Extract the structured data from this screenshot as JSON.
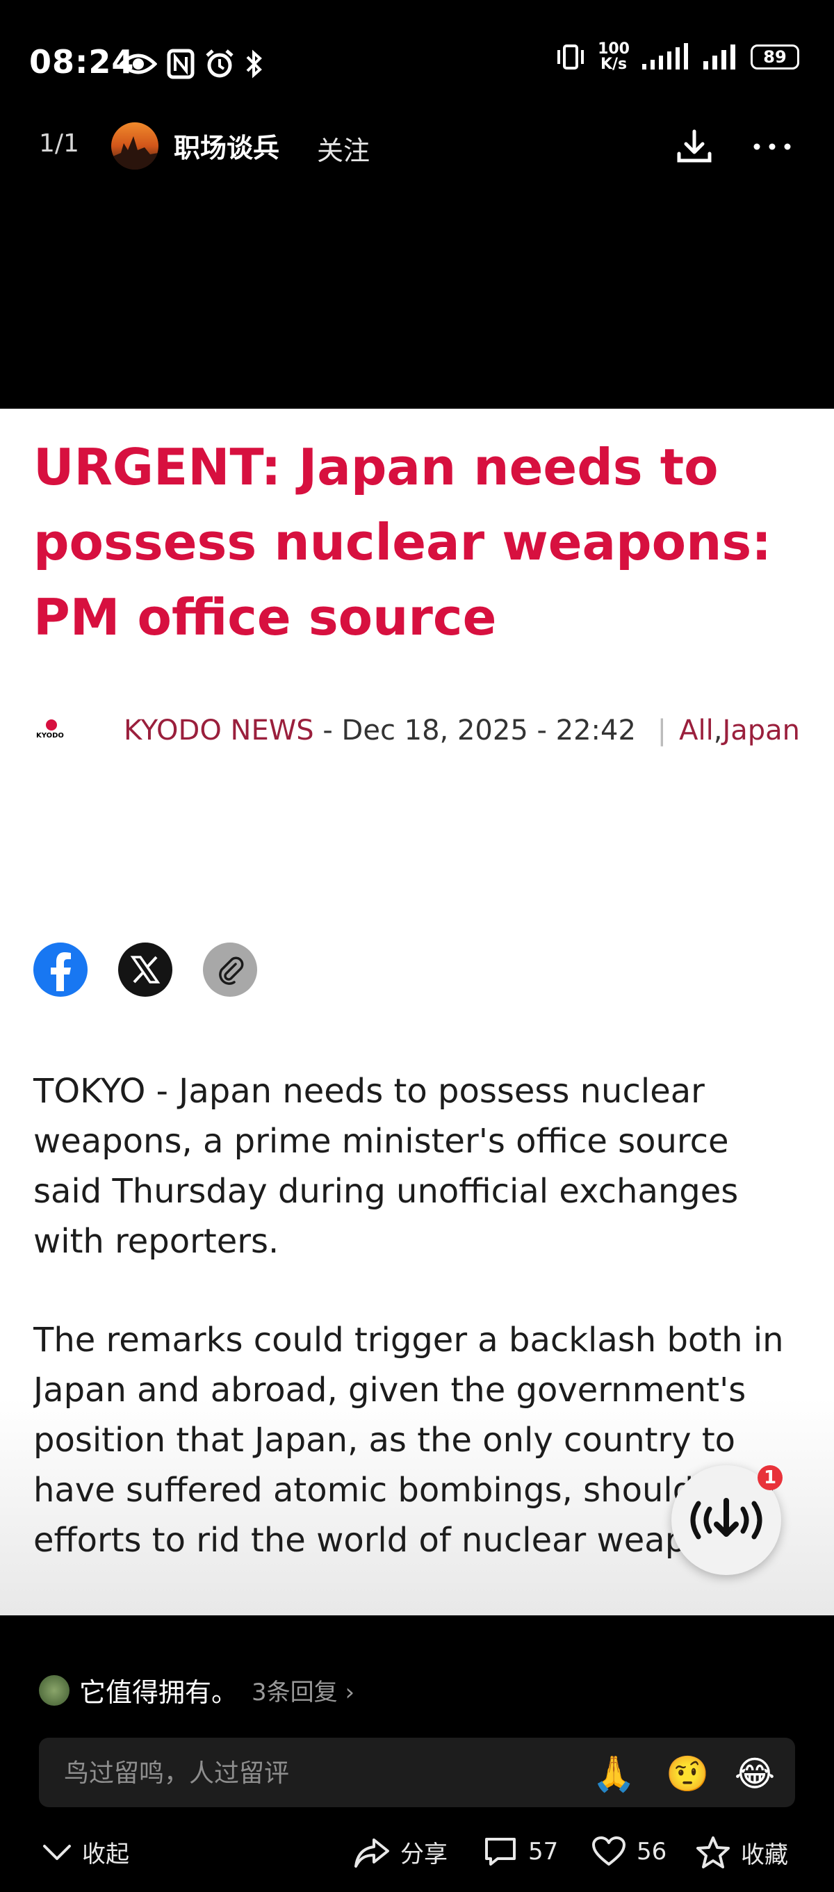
{
  "status_bar": {
    "time": "08:24",
    "net_speed_top": "100",
    "net_speed_bottom": "K/s",
    "battery": "89"
  },
  "header": {
    "page_indicator": "1/1",
    "author": "职场谈兵",
    "follow_label": "关注"
  },
  "article": {
    "headline": "URGENT: Japan needs to possess nuclear weapons: PM office source",
    "logo_text": "KYODO",
    "source": "KYODO NEWS",
    "date": " - Dec 18, 2025 - 22:42 ",
    "category_1": "All",
    "category_2": "Japan",
    "paragraph_1": "TOKYO - Japan needs to possess nuclear weapons, a prime minister's office source said Thursday during unofficial exchanges with reporters.",
    "paragraph_2": "The remarks could trigger a backlash both in Japan and abroad, given the government's position that Japan, as the only country to have suffered atomic bombings, should lead efforts to rid the world of nuclear weapons.",
    "audio_badge": "1"
  },
  "comments": {
    "preview_text": "它值得拥有。",
    "replies_label": "3条回复 ›",
    "input_placeholder": "鸟过留鸣，人过留评",
    "emojis": [
      "🙏",
      "🤨",
      "😂"
    ]
  },
  "toolbar": {
    "collapse_label": "收起",
    "share_label": "分享",
    "comment_count": "57",
    "like_count": "56",
    "favorite_label": "收藏"
  },
  "colors": {
    "headline": "#d7103f",
    "link": "#9a1f3c",
    "facebook": "#1877f2"
  }
}
